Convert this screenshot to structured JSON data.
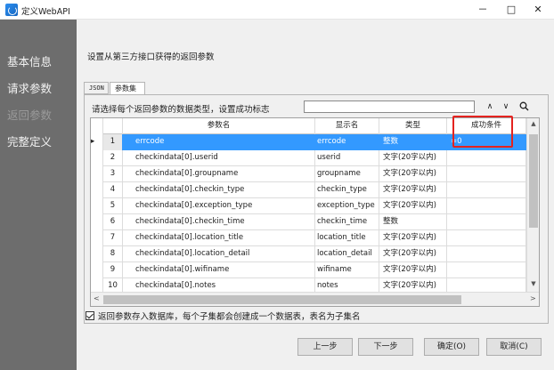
{
  "window": {
    "title": "定义WebAPI",
    "min": "－",
    "max": "□",
    "close": "✕"
  },
  "sidebar": {
    "items": [
      {
        "label": "基本信息"
      },
      {
        "label": "请求参数"
      },
      {
        "label": "返回参数"
      },
      {
        "label": "完整定义"
      }
    ]
  },
  "main": {
    "heading": "设置从第三方接口获得的返回参数",
    "tabs": [
      {
        "label": "JSON"
      },
      {
        "label": "参数集"
      }
    ],
    "hint": "请选择每个返回参数的数据类型，设置成功标志",
    "search": {
      "value": "",
      "placeholder": ""
    },
    "nav": {
      "up": "∧",
      "down": "∨"
    },
    "table": {
      "columns": {
        "name": "参数名",
        "display": "显示名",
        "type": "类型",
        "condition": "成功条件"
      },
      "rows": [
        {
          "indicator": "▸",
          "num": "1",
          "name": "errcode",
          "display": "errcode",
          "type": "整数",
          "condition": "=0"
        },
        {
          "indicator": "",
          "num": "2",
          "name": "checkindata[0].userid",
          "display": "userid",
          "type": "文字(20字以内)",
          "condition": ""
        },
        {
          "indicator": "",
          "num": "3",
          "name": "checkindata[0].groupname",
          "display": "groupname",
          "type": "文字(20字以内)",
          "condition": ""
        },
        {
          "indicator": "",
          "num": "4",
          "name": "checkindata[0].checkin_type",
          "display": "checkin_type",
          "type": "文字(20字以内)",
          "condition": ""
        },
        {
          "indicator": "",
          "num": "5",
          "name": "checkindata[0].exception_type",
          "display": "exception_type",
          "type": "文字(20字以内)",
          "condition": ""
        },
        {
          "indicator": "",
          "num": "6",
          "name": "checkindata[0].checkin_time",
          "display": "checkin_time",
          "type": "整数",
          "condition": ""
        },
        {
          "indicator": "",
          "num": "7",
          "name": "checkindata[0].location_title",
          "display": "location_title",
          "type": "文字(20字以内)",
          "condition": ""
        },
        {
          "indicator": "",
          "num": "8",
          "name": "checkindata[0].location_detail",
          "display": "location_detail",
          "type": "文字(20字以内)",
          "condition": ""
        },
        {
          "indicator": "",
          "num": "9",
          "name": "checkindata[0].wifiname",
          "display": "wifiname",
          "type": "文字(20字以内)",
          "condition": ""
        },
        {
          "indicator": "",
          "num": "10",
          "name": "checkindata[0].notes",
          "display": "notes",
          "type": "文字(20字以内)",
          "condition": ""
        }
      ]
    },
    "scroll": {
      "up": "▲",
      "down": "▼",
      "left": "<",
      "right": ">"
    },
    "checkbox_label": "返回参数存入数据库，每个子集都会创建成一个数据表，表名为子集名",
    "buttons": {
      "prev": "上一步",
      "next": "下一步",
      "ok": "确定(O)",
      "cancel": "取消(C)"
    }
  },
  "colors": {
    "sidebar": "#6d6d6d",
    "selection": "#3399ff",
    "highlight": "#e4231f"
  }
}
